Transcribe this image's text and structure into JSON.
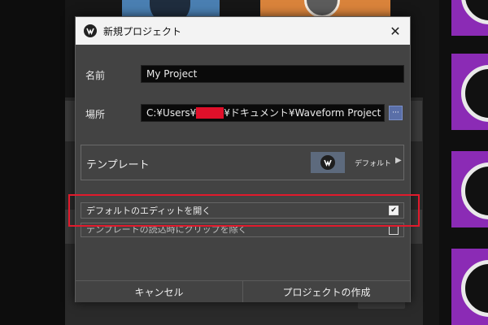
{
  "dialog": {
    "title": "新規プロジェクト",
    "close_symbol": "✕"
  },
  "form": {
    "name_label": "名前",
    "name_value": "My Project",
    "location_label": "場所",
    "location_prefix": "C:¥Users¥",
    "location_suffix": "¥ドキュメント¥Waveform Project",
    "browse_label": "···",
    "template_label": "テンプレート",
    "template_value": "デフォルト",
    "template_arrow": "▶"
  },
  "options": [
    {
      "label": "デフォルトのエディットを開く",
      "checked": true
    },
    {
      "label": "テンプレートの読込時にクリップを除く",
      "checked": false
    }
  ],
  "footer": {
    "cancel_label": "キャンセル",
    "create_label": "プロジェクトの作成"
  },
  "colors": {
    "accent_highlight": "#e11a2c",
    "dialog_bg": "#434343",
    "titlebar_bg": "#f3f3f3"
  },
  "icons": {
    "app": "waveform-logo-icon",
    "close": "close-icon",
    "template_thumb": "waveform-logo-icon",
    "check": "check-icon"
  }
}
